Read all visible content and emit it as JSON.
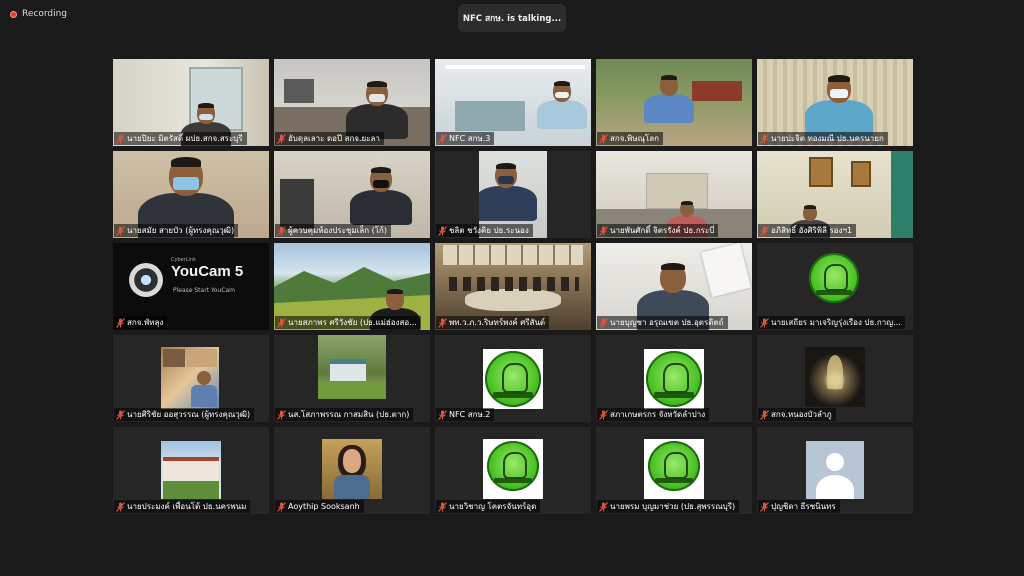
{
  "recording": {
    "label": "Recording"
  },
  "talking": {
    "label": "NFC สกษ. is talking..."
  },
  "colors": {
    "recording_dot": "#e2412f",
    "mic_muted": "#e0533d",
    "logo_green": "#4fc428",
    "background": "#1a1a1a"
  },
  "participants": [
    {
      "name": "นายปิยะ มิตรัสดิ์ ผปธ.สกจ.สระบุรี",
      "scene": "office-window"
    },
    {
      "name": "อับดุลเลาะ ดอปี สกจ.ยะลา",
      "scene": "office-desk"
    },
    {
      "name": "NFC สกษ.3",
      "scene": "office-bright"
    },
    {
      "name": "สกจ.พิษณุโลก",
      "scene": "outdoor"
    },
    {
      "name": "นายปะจิต ทองมณี ปธ.นครนายก",
      "scene": "curtain"
    },
    {
      "name": "นายสมัย สายบัว (ผู้ทรงคุณวุฒิ)",
      "scene": "man-mask-big"
    },
    {
      "name": "ผู้ควบคุมห้องประชุมเล็ก (โก้)",
      "scene": "man-sitting"
    },
    {
      "name": "ชลิต ชวังคิย ปธ.ระนอง",
      "scene": "small-man"
    },
    {
      "name": "นายพันศักดิ์ จิตรรังค์ ปธ.กระบี่",
      "scene": "room-far"
    },
    {
      "name": "อภิสิทธิ์ อังศิริพิลี รองฯ1",
      "scene": "room-pictures"
    },
    {
      "name": "สกจ.พัทลุง",
      "scene": "youcam",
      "app": "YouCam 5",
      "brand": "CyberLink",
      "hint": "Please Start YouCam"
    },
    {
      "name": "นายสภาพร ศรีวังชัย (ปธ.แม่ฮ่องสอ...",
      "scene": "mountain"
    },
    {
      "name": "พท.ว.ภ.ว.ริษทร์พงค์ ศรีสันต์",
      "scene": "meeting"
    },
    {
      "name": "นายบุญชา อรุณเขต ปธ.อุตรดิตถ์",
      "scene": "man-paper"
    },
    {
      "name": "นายเสถียร มาเจริญรุ่งเรือง ปธ.กาญ...",
      "scene": "logo"
    },
    {
      "name": "นายศิริชัย ออสุวรรณ (ผู้ทรงคุณวุฒิ)",
      "scene": "photo-collage"
    },
    {
      "name": "นส.โสภาพรรณ กาสมสิน (ปธ.ตาก)",
      "scene": "photo-house"
    },
    {
      "name": "NFC สกษ.2",
      "scene": "logo-small"
    },
    {
      "name": "สภาเกษตรกร จังหวัดลำปาง",
      "scene": "logo-small"
    },
    {
      "name": "สกจ.หนองบัวลำภู",
      "scene": "photo-night"
    },
    {
      "name": "นายประมงค์ เพื่อนโต้ ปธ.นครพนม",
      "scene": "photo-building"
    },
    {
      "name": "Aoythip Sooksanh",
      "scene": "photo-woman"
    },
    {
      "name": "นายวิชาญ โคตรจันทร์อุด",
      "scene": "logo-card"
    },
    {
      "name": "นายพรม บุญมาช่วย (ปธ.สุพรรณบุรี)",
      "scene": "logo-card"
    },
    {
      "name": "ปุญชิดา ธีรชนินทร",
      "scene": "avatar"
    }
  ]
}
